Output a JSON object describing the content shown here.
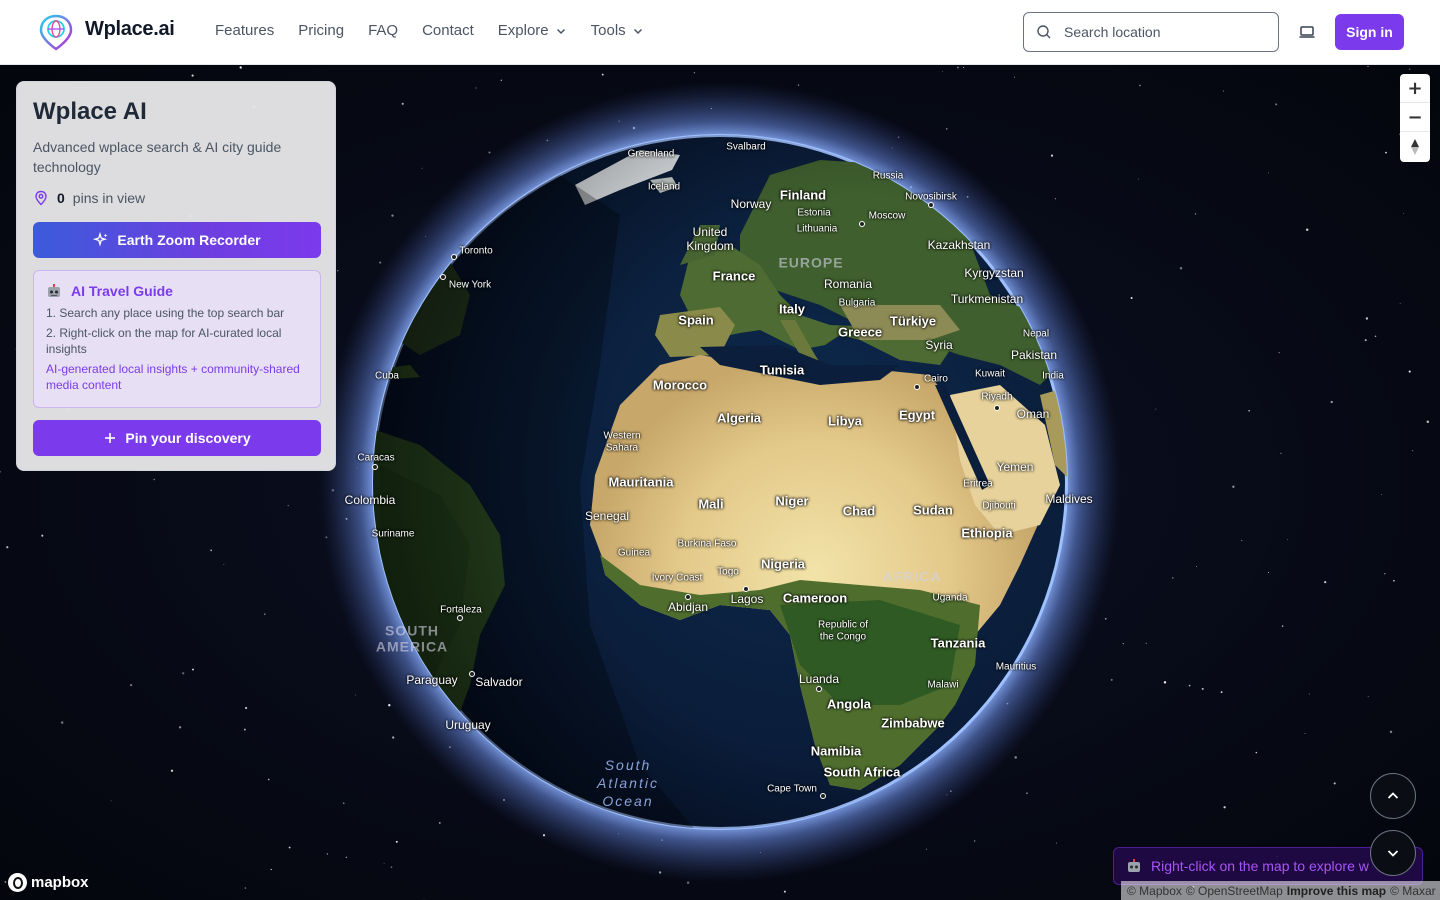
{
  "header": {
    "brand": "Wplace.ai",
    "nav": [
      "Features",
      "Pricing",
      "FAQ",
      "Contact",
      "Explore",
      "Tools"
    ],
    "search_placeholder": "Search location",
    "signin_label": "Sign in"
  },
  "panel": {
    "title": "Wplace AI",
    "subtitle": "Advanced wplace search & AI city guide technology",
    "pins_count": "0",
    "pins_label": "pins in view",
    "zoom_recorder_label": "Earth Zoom Recorder",
    "guide": {
      "title": "AI Travel Guide",
      "step1": "1. Search any place using the top search bar",
      "step2": "2. Right-click on the map for AI-curated local insights",
      "note": "AI-generated local insights + community-shared media content"
    },
    "pin_button_label": "Pin your discovery"
  },
  "map": {
    "controls": {
      "zoom_in": "+",
      "zoom_out": "−"
    },
    "toast": "Right-click on the map to explore w",
    "mapbox_logo": "mapbox",
    "attribution": {
      "mapbox": "© Mapbox",
      "osm": "© OpenStreetMap",
      "improve": "Improve this map",
      "maxar": "© Maxar"
    },
    "labels": {
      "greenland": "Greenland",
      "svalbard": "Svalbard",
      "iceland": "Iceland",
      "russia": "Russia",
      "finland": "Finland",
      "norway": "Norway",
      "novosibirsk": "Novosibirsk",
      "estonia": "Estonia",
      "moscow": "Moscow",
      "lithuania": "Lithuania",
      "uk1": "United",
      "uk2": "Kingdom",
      "europe": "EUROPE",
      "kazakhstan": "Kazakhstan",
      "toronto": "Toronto",
      "newyork": "New York",
      "france": "France",
      "romania": "Romania",
      "bulgaria": "Bulgaria",
      "kyrgyzstan": "Kyrgyzstan",
      "turkmenistan": "Turkmenistan",
      "spain": "Spain",
      "italy": "Italy",
      "greece": "Greece",
      "turkiye": "Türkiye",
      "nepal": "Nepal",
      "syria": "Syria",
      "pakistan": "Pakistan",
      "tunisia": "Tunisia",
      "cuba": "Cuba",
      "cairo": "Cairo",
      "kuwait": "Kuwait",
      "india": "India",
      "morocco": "Morocco",
      "riyadh": "Riyadh",
      "oman": "Oman",
      "algeria": "Algeria",
      "libya": "Libya",
      "egypt": "Egypt",
      "ws1": "Western",
      "ws2": "Sahara",
      "caracas": "Caracas",
      "yemen": "Yemen",
      "mauritania": "Mauritania",
      "eritrea": "Eritrea",
      "colombia": "Colombia",
      "mali": "Mali",
      "niger": "Niger",
      "chad": "Chad",
      "sudan": "Sudan",
      "djibouti": "Djibouti",
      "maldives": "Maldives",
      "senegal": "Senegal",
      "suriname": "Suriname",
      "ethiopia": "Ethiopia",
      "burkina": "Burkina Faso",
      "guinea": "Guinea",
      "nigeria": "Nigeria",
      "africa": "AFRICA",
      "togo": "Togo",
      "ivory": "Ivory Coast",
      "abidjan": "Abidjan",
      "lagos": "Lagos",
      "cameroon": "Cameroon",
      "uganda": "Uganda",
      "fortaleza": "Fortaleza",
      "rc1": "Republic of",
      "rc2": "the Congo",
      "sa1": "SOUTH",
      "sa2": "AMERICA",
      "tanzania": "Tanzania",
      "mauritius": "Mauritius",
      "paraguay": "Paraguay",
      "salvador": "Salvador",
      "luanda": "Luanda",
      "malawi": "Malawi",
      "angola": "Angola",
      "zimbabwe": "Zimbabwe",
      "uruguay": "Uruguay",
      "namibia": "Namibia",
      "o1": "South",
      "o2": "Atlantic",
      "o3": "Ocean",
      "southafrica": "South Africa",
      "capetown": "Cape Town"
    }
  },
  "colors": {
    "accent": "#7c3aed",
    "blue": "#3b5bdb",
    "space": "#05070f"
  }
}
